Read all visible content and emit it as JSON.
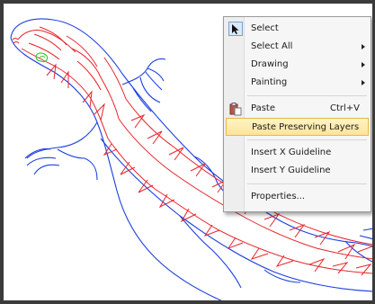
{
  "menu": {
    "items": [
      {
        "label": "Select",
        "shortcut": "",
        "submenu": false,
        "icon": "select-arrow-icon"
      },
      {
        "label": "Select All",
        "shortcut": "",
        "submenu": true,
        "icon": ""
      },
      {
        "label": "Drawing",
        "shortcut": "",
        "submenu": true,
        "icon": ""
      },
      {
        "label": "Painting",
        "shortcut": "",
        "submenu": true,
        "icon": ""
      },
      {
        "label": "Paste",
        "shortcut": "Ctrl+V",
        "submenu": false,
        "icon": "paste-icon"
      },
      {
        "label": "Paste Preserving Layers",
        "shortcut": "",
        "submenu": false,
        "icon": "",
        "highlighted": true
      },
      {
        "label": "Insert X Guideline",
        "shortcut": "",
        "submenu": false,
        "icon": ""
      },
      {
        "label": "Insert Y Guideline",
        "shortcut": "",
        "submenu": false,
        "icon": ""
      },
      {
        "label": "Properties...",
        "shortcut": "",
        "submenu": false,
        "icon": ""
      }
    ]
  },
  "colors": {
    "outline": "#1c3fe0",
    "fill_lines": "#e8242a",
    "eye": "#2fd02f",
    "highlight": "#fde49a"
  }
}
